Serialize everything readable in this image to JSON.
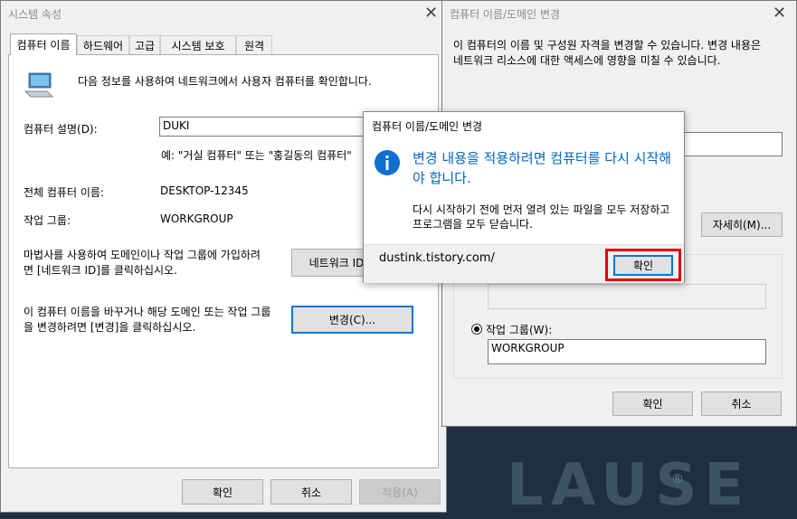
{
  "background": {
    "color": "#1e2f3f"
  },
  "sys_props": {
    "title": "시스템 속성",
    "tabs": [
      "컴퓨터 이름",
      "하드웨어",
      "고급",
      "시스템 보호",
      "원격"
    ],
    "intro": "다음 정보를 사용하여 네트워크에서 사용자 컴퓨터를 확인합니다.",
    "desc_label": "컴퓨터 설명(D):",
    "desc_value": "DUKI",
    "example": "예: \"거실 컴퓨터\" 또는 \"홍길동의 컴퓨터\"",
    "fullname_label": "전체 컴퓨터 이름:",
    "fullname_value": "DESKTOP-12345",
    "workgroup_label": "작업 그룹:",
    "workgroup_value": "WORKGROUP",
    "wizard_text": "마법사를 사용하여 도메인이나 작업 그룹에 가입하려면 [네트워크 ID]를 클릭하십시오.",
    "network_id_button": "네트워크 ID",
    "change_text": "이 컴퓨터 이름을 바꾸거나 해당 도메인 또는 작업 그룹을 변경하려면 [변경]을 클릭하십시오.",
    "change_button": "변경(C)...",
    "ok": "확인",
    "cancel": "취소",
    "apply": "적용(A)"
  },
  "name_change": {
    "title": "컴퓨터 이름/도메인 변경",
    "intro": "이 컴퓨터의 이름 및 구성원 자격을 변경할 수 있습니다. 변경 내용은 네트워크 리소스에 대한 액세스에 영향을 미칠 수 있습니다.",
    "more_button": "자세히(M)...",
    "workgroup_radio": "작업 그룹(W):",
    "workgroup_value": "WORKGROUP",
    "ok": "확인",
    "cancel": "취소"
  },
  "message_box": {
    "title": "컴퓨터 이름/도메인 변경",
    "icon": "info-icon",
    "main_instruction": "변경 내용을 적용하려면 컴퓨터를 다시 시작해야 합니다.",
    "content": "다시 시작하기 전에 먼저 열려 있는 파일을 모두 저장하고 프로그램을 모두 닫습니다.",
    "footer_text": "dustink.tistory.com/",
    "ok": "확인",
    "highlight_color": "#e00000",
    "accent_color": "#0067c0"
  }
}
